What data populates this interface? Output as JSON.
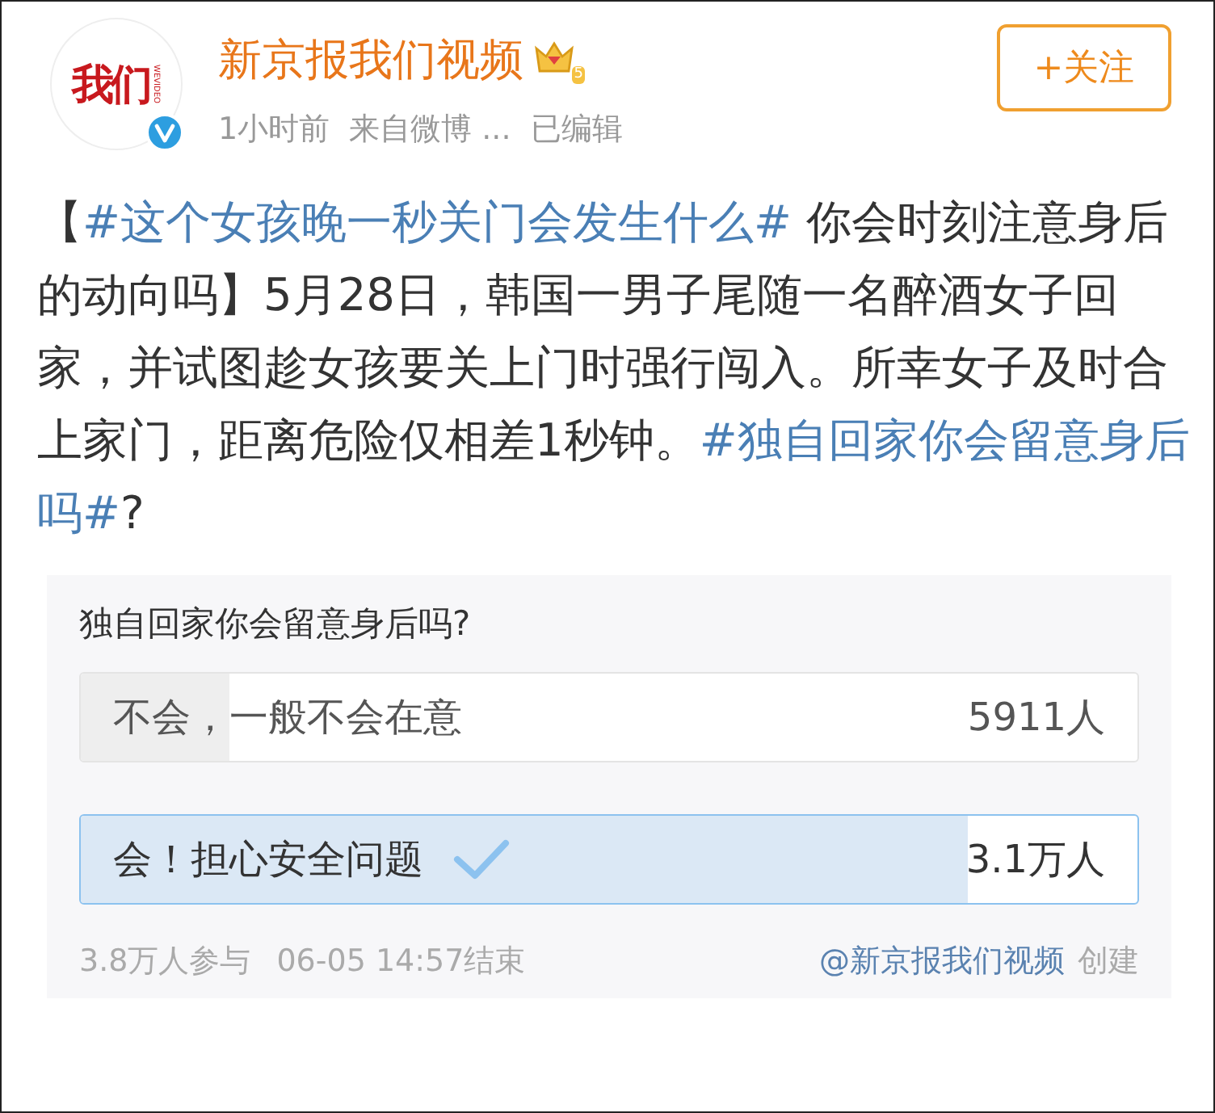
{
  "author": {
    "avatar_logo": "我们",
    "avatar_sub": "WEVIDEO",
    "verified": true,
    "name": "新京报我们视频",
    "vip_level": "5",
    "time": "1小时前",
    "source": "来自微博 ...",
    "edited": "已编辑"
  },
  "follow_button": {
    "label": "+关注"
  },
  "post": [
    {
      "kind": "text",
      "text": "【"
    },
    {
      "kind": "hashtag",
      "text": "#这个女孩晚一秒关门会发生什么#"
    },
    {
      "kind": "text",
      "text": " 你会时刻注意身后的动向吗】5月28日，韩国一男子尾随一名醉酒女子回家，并试图趁女孩要关上门时强行闯入。所幸女子及时合上家门，距离危险仅相差1秒钟。"
    },
    {
      "kind": "hashtag",
      "text": "#独自回家你会留意身后吗#"
    },
    {
      "kind": "text",
      "text": "?"
    }
  ],
  "poll": {
    "question": "独自回家你会留意身后吗?",
    "options": [
      {
        "label": "不会，一般不会在意",
        "count": "5911人",
        "level": 0.14,
        "selected": false
      },
      {
        "label": "会！担心安全问题",
        "count": "3.1万人",
        "level": 0.84,
        "selected": true
      }
    ],
    "participants": "3.8万人参与",
    "ended": "06-05 14:57结束",
    "creator": "@新京报我们视频",
    "created": "创建"
  }
}
